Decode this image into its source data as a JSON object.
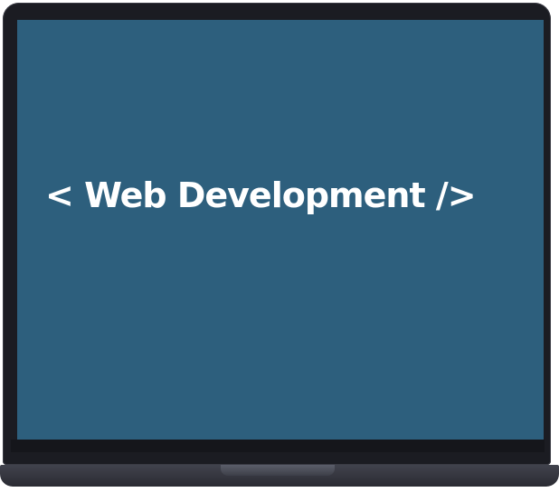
{
  "screen": {
    "title": "< Web Development />"
  },
  "colors": {
    "screen_bg": "#2d5f7d",
    "bezel": "#1b1c22",
    "text": "#ffffff"
  }
}
